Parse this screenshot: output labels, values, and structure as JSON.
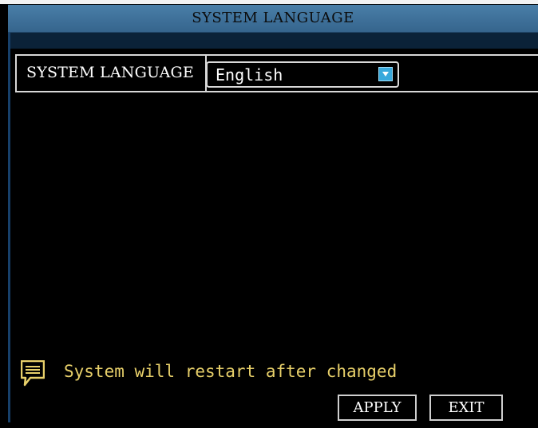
{
  "window": {
    "title": "SYSTEM LANGUAGE"
  },
  "settings": {
    "language_label": "SYSTEM LANGUAGE",
    "language_value": "English",
    "dropdown_icon": "chevron-down-icon"
  },
  "notice": {
    "icon": "message-icon",
    "text": "System will restart after changed"
  },
  "buttons": {
    "apply": "APPLY",
    "exit": "EXIT"
  },
  "colors": {
    "titlebar": "#4a7fa8",
    "background": "#000000",
    "notice_text": "#e8d06a",
    "dropdown_accent": "#39a9dc",
    "border": "#d8d8d8"
  }
}
